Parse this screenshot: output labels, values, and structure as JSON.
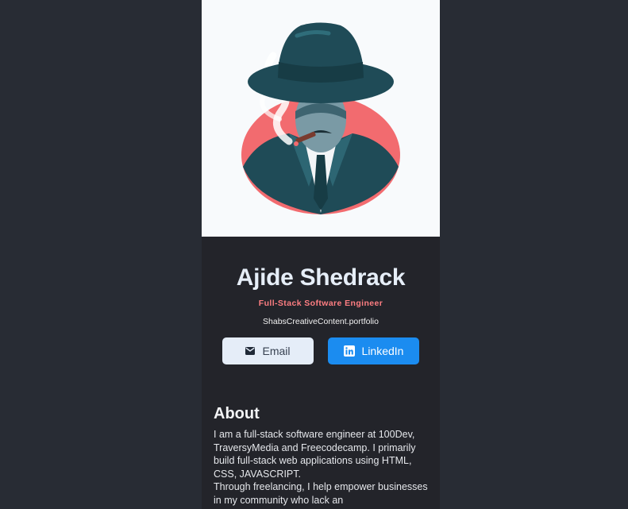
{
  "profile": {
    "image": "detective-avatar-illustration",
    "name": "Ajide Shedrack",
    "title": "Full-Stack Software Engineer",
    "website": "ShabsCreativeContent.portfolio"
  },
  "buttons": {
    "email_label": "Email",
    "email_icon": "mail-icon",
    "linkedin_label": "LinkedIn",
    "linkedin_icon": "linkedin-icon"
  },
  "about": {
    "heading": "About",
    "paragraph1": "I am a full-stack software engineer at 100Dev, TraversyMedia and Freecodecamp. I primarily build full-stack web applications using HTML, CSS, JAVASCRIPT.",
    "paragraph2": "Through freelancing, I help empower businesses in my community who lack an"
  },
  "colors": {
    "page_bg": "#282c34",
    "card_bg": "#23242a",
    "accent": "#ff7e82",
    "email_button": "#e5edf8",
    "linkedin_button": "#1b8cf0"
  }
}
